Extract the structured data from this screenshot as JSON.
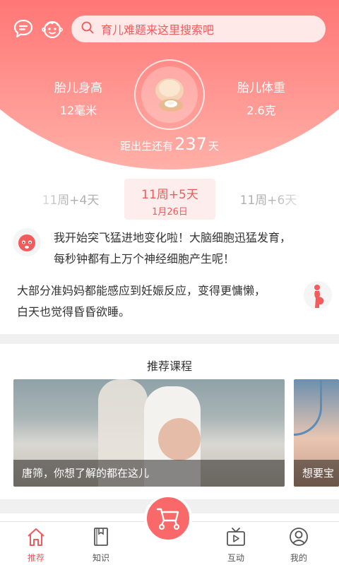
{
  "header": {
    "search_placeholder": "育儿难题来这里搜索吧",
    "height_label": "胎儿身高",
    "height_value": "12毫米",
    "weight_label": "胎儿体重",
    "weight_value": "2.6克",
    "countdown_prefix": "距出生还有",
    "countdown_days": "237",
    "countdown_suffix": "天"
  },
  "weeks": {
    "prev": "11周+4天",
    "current": "11周+5天",
    "current_date": "1月26日",
    "next": "11周+6天"
  },
  "messages": {
    "baby_text_1": "我开始突飞猛进地变化啦！大脑细胞迅猛发育，",
    "baby_text_2": "每秒钟都有上万个神经细胞产生呢！",
    "mom_text_1": "大部分准妈妈都能感应到妊娠反应，变得更慵懒，",
    "mom_text_2": "白天也觉得昏昏欲睡。"
  },
  "courses": {
    "title": "推荐课程",
    "card1_caption": "唐筛，你想了解的都在这儿",
    "card2_caption": "想要宝"
  },
  "nav": {
    "home": "推荐",
    "knowledge": "知识",
    "interact": "互动",
    "mine": "我的"
  },
  "colors": {
    "brand": "#ff6b6b",
    "accent_text": "#ef5a5a"
  },
  "icons": [
    "message-icon",
    "baby-face-icon",
    "search-icon",
    "shell-icon",
    "baby-avatar-icon",
    "pregnant-mom-icon",
    "home-icon",
    "book-icon",
    "stroller-icon",
    "tv-icon",
    "user-icon"
  ]
}
